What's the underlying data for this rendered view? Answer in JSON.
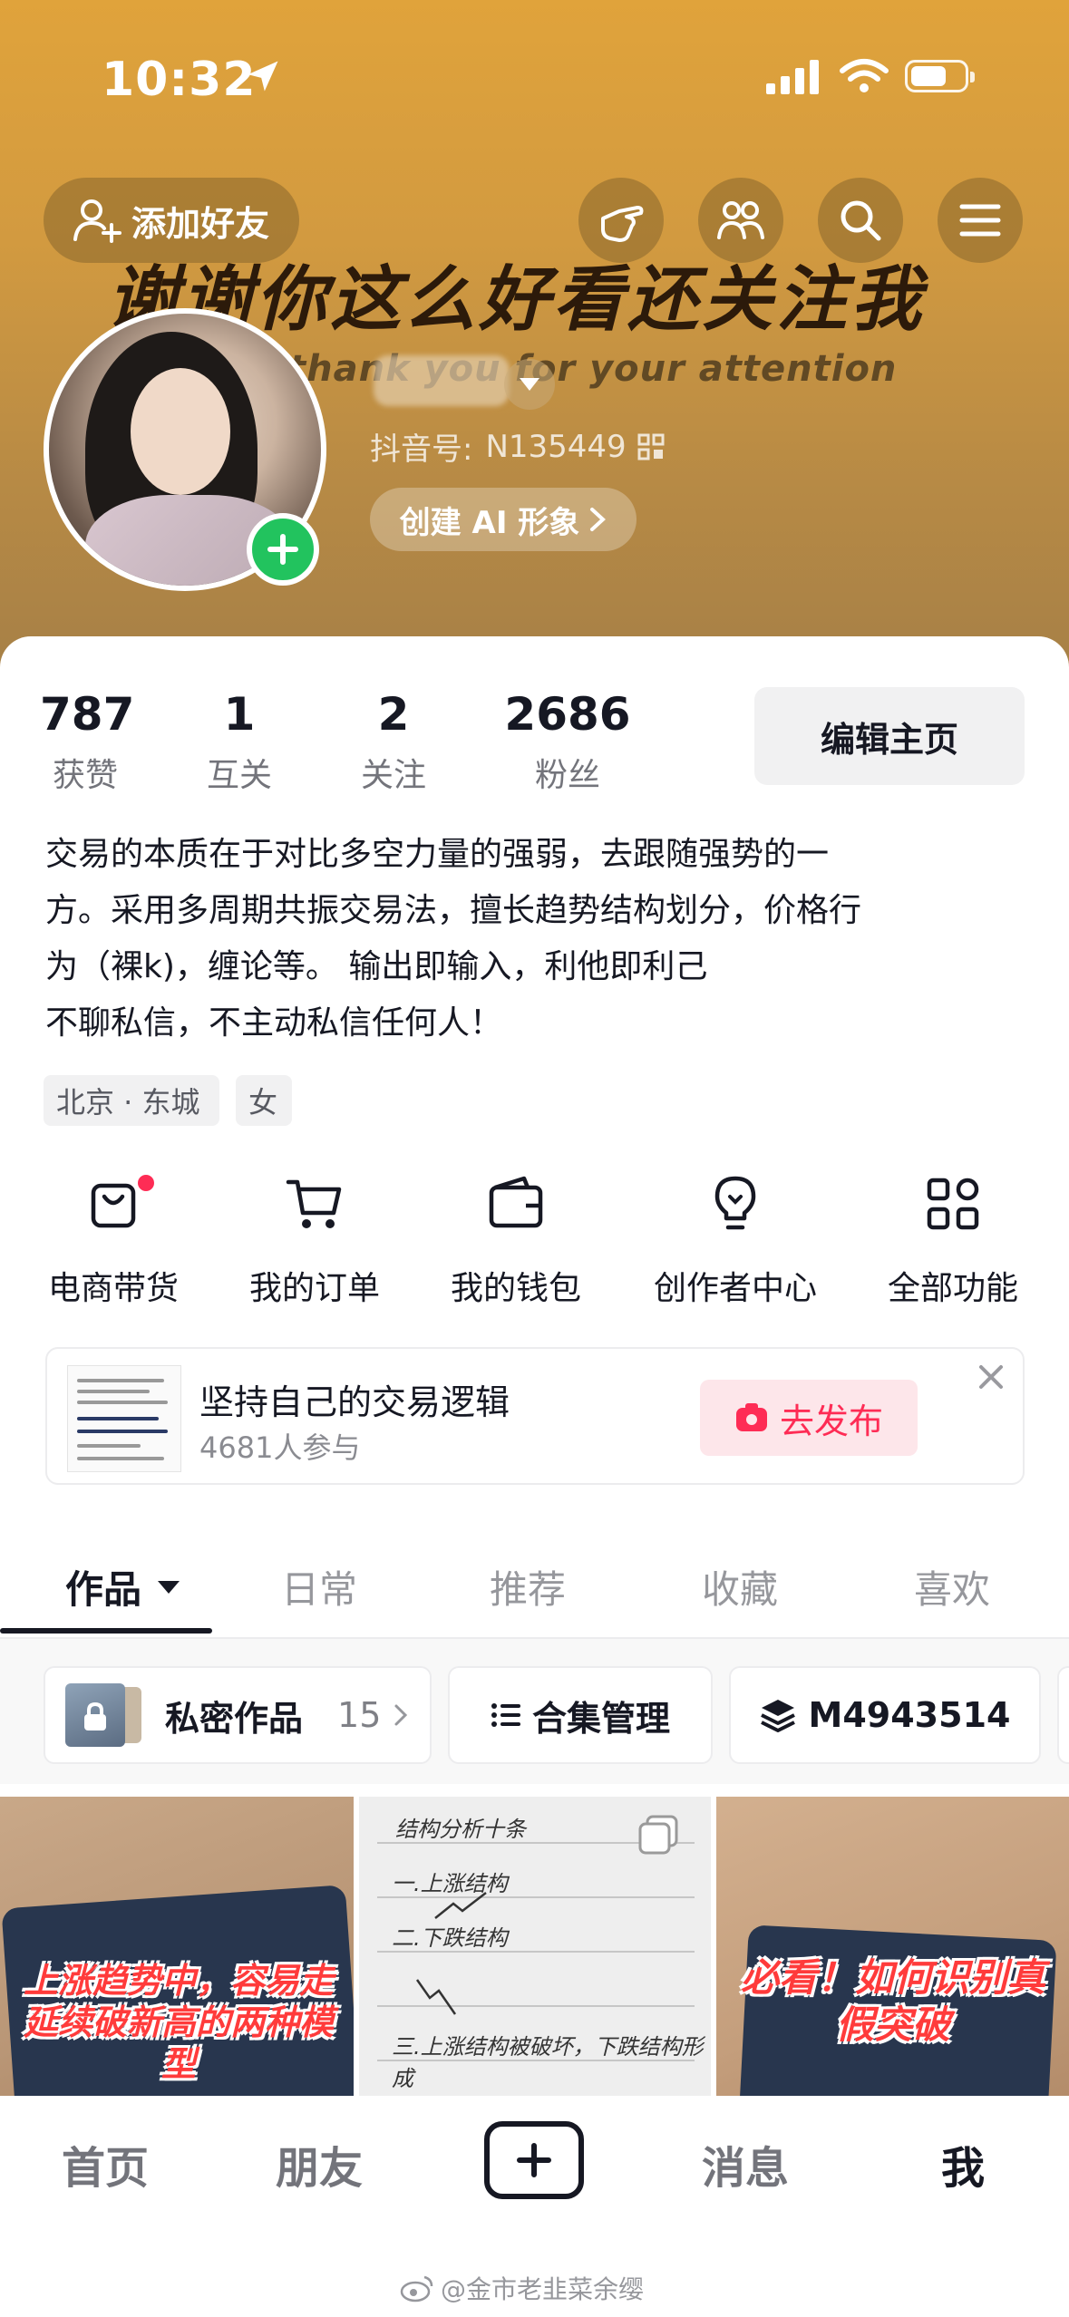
{
  "status_bar": {
    "time": "10:32"
  },
  "header": {
    "add_friend_label": "添加好友",
    "banner_text_cn": "谢谢你这么好看还关注我",
    "banner_text_en": "thank you for your attention",
    "douyin_id_label": "抖音号:",
    "douyin_id_value": "N135449",
    "create_ai_label": "创建 AI 形象"
  },
  "stats": [
    {
      "value": "787",
      "label": "获赞"
    },
    {
      "value": "1",
      "label": "互关"
    },
    {
      "value": "2",
      "label": "关注"
    },
    {
      "value": "2686",
      "label": "粉丝"
    }
  ],
  "edit_profile_label": "编辑主页",
  "bio_lines": [
    "交易的本质在于对比多空力量的强弱，去跟随强势的一",
    "方。采用多周期共振交易法，擅长趋势结构划分，价格行",
    "为（裸k)，缠论等。 输出即输入，利他即利己",
    "不聊私信，不主动私信任何人！"
  ],
  "tags": [
    "北京 · 东城",
    "女"
  ],
  "functions": [
    {
      "label": "电商带货",
      "icon": "shopping-bag-icon"
    },
    {
      "label": "我的订单",
      "icon": "cart-icon"
    },
    {
      "label": "我的钱包",
      "icon": "wallet-icon"
    },
    {
      "label": "创作者中心",
      "icon": "lightbulb-icon"
    },
    {
      "label": "全部功能",
      "icon": "grid-icon"
    }
  ],
  "topic": {
    "title": "坚持自己的交易逻辑",
    "participants": "4681人参与",
    "publish_label": "去发布"
  },
  "tabs": [
    "作品",
    "日常",
    "推荐",
    "收藏",
    "喜欢"
  ],
  "filters": {
    "private_label": "私密作品",
    "private_count": "15",
    "collection_label": "合集管理",
    "code_label": "M4943514"
  },
  "videos": [
    {
      "caption": "上涨趋势中，容易走延续破新高的两种模型"
    },
    {
      "notes": [
        "结构分析十条",
        "一.上涨结构",
        "二.下跌结构",
        "三.上涨结构被破坏，下跌结构形成"
      ]
    },
    {
      "caption": "必看！如何识别真假突破"
    }
  ],
  "bottom_nav": [
    "首页",
    "朋友",
    "消息",
    "我"
  ],
  "watermark": "@金市老韭菜余缨",
  "colors": {
    "accent_red": "#fe2c55",
    "green_plus": "#22c35e",
    "header_gold": "#d9a03d"
  }
}
